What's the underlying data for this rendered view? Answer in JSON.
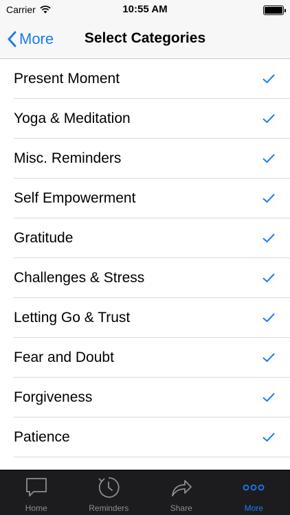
{
  "status": {
    "carrier": "Carrier",
    "time": "10:55 AM"
  },
  "nav": {
    "back_label": "More",
    "title": "Select Categories"
  },
  "categories": [
    {
      "label": "Present Moment",
      "checked": true
    },
    {
      "label": "Yoga & Meditation",
      "checked": true
    },
    {
      "label": "Misc. Reminders",
      "checked": true
    },
    {
      "label": "Self Empowerment",
      "checked": true
    },
    {
      "label": "Gratitude",
      "checked": true
    },
    {
      "label": "Challenges & Stress",
      "checked": true
    },
    {
      "label": "Letting Go & Trust",
      "checked": true
    },
    {
      "label": "Fear and Doubt",
      "checked": true
    },
    {
      "label": "Forgiveness",
      "checked": true
    },
    {
      "label": "Patience",
      "checked": true
    }
  ],
  "tabs": [
    {
      "label": "Home",
      "icon": "speech-bubble-icon",
      "active": false
    },
    {
      "label": "Reminders",
      "icon": "clock-icon",
      "active": false
    },
    {
      "label": "Share",
      "icon": "share-arrow-icon",
      "active": false
    },
    {
      "label": "More",
      "icon": "ellipsis-icon",
      "active": true
    }
  ],
  "colors": {
    "accent": "#1a7cf5",
    "tab_bar_bg": "#1c1c1e",
    "tab_inactive": "#8e8e93"
  }
}
